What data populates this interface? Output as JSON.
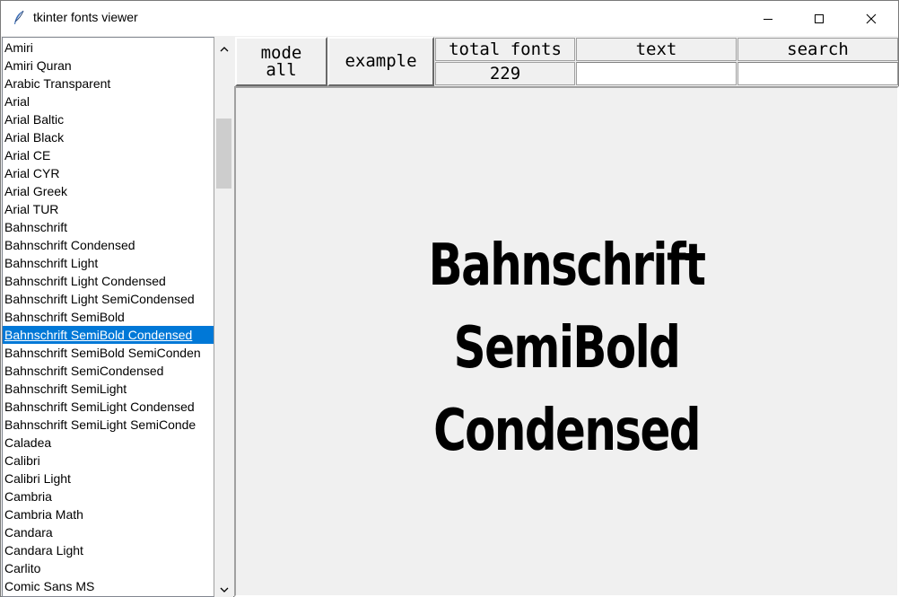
{
  "window": {
    "title": "tkinter fonts viewer"
  },
  "icons": {
    "app": "feather-icon",
    "minimize": "minimize-icon",
    "maximize": "maximize-icon",
    "close": "close-icon",
    "scroll_up": "chevron-up-icon",
    "scroll_down": "chevron-down-icon"
  },
  "fonts_list": {
    "items": [
      "Amiri",
      "Amiri Quran",
      "Arabic Transparent",
      "Arial",
      "Arial Baltic",
      "Arial Black",
      "Arial CE",
      "Arial CYR",
      "Arial Greek",
      "Arial TUR",
      "Bahnschrift",
      "Bahnschrift Condensed",
      "Bahnschrift Light",
      "Bahnschrift Light Condensed",
      "Bahnschrift Light SemiCondensed",
      "Bahnschrift SemiBold",
      "Bahnschrift SemiBold Condensed",
      "Bahnschrift SemiBold SemiConden",
      "Bahnschrift SemiCondensed",
      "Bahnschrift SemiLight",
      "Bahnschrift SemiLight Condensed",
      "Bahnschrift SemiLight SemiConde",
      "Caladea",
      "Calibri",
      "Calibri Light",
      "Cambria",
      "Cambria Math",
      "Candara",
      "Candara Light",
      "Carlito",
      "Comic Sans MS"
    ],
    "selected_index": 16
  },
  "toolbar": {
    "mode_line1": "mode",
    "mode_line2": "all",
    "example_label": "example",
    "total_fonts_label": "total fonts",
    "total_fonts_value": "229",
    "text_label": "text",
    "search_label": "search",
    "text_value": "",
    "search_value": ""
  },
  "preview": {
    "line1": "Bahnschrift SemiBold",
    "line2": "Condensed"
  },
  "colors": {
    "selection": "#0078d7",
    "window_bg": "#f0f0f0"
  }
}
